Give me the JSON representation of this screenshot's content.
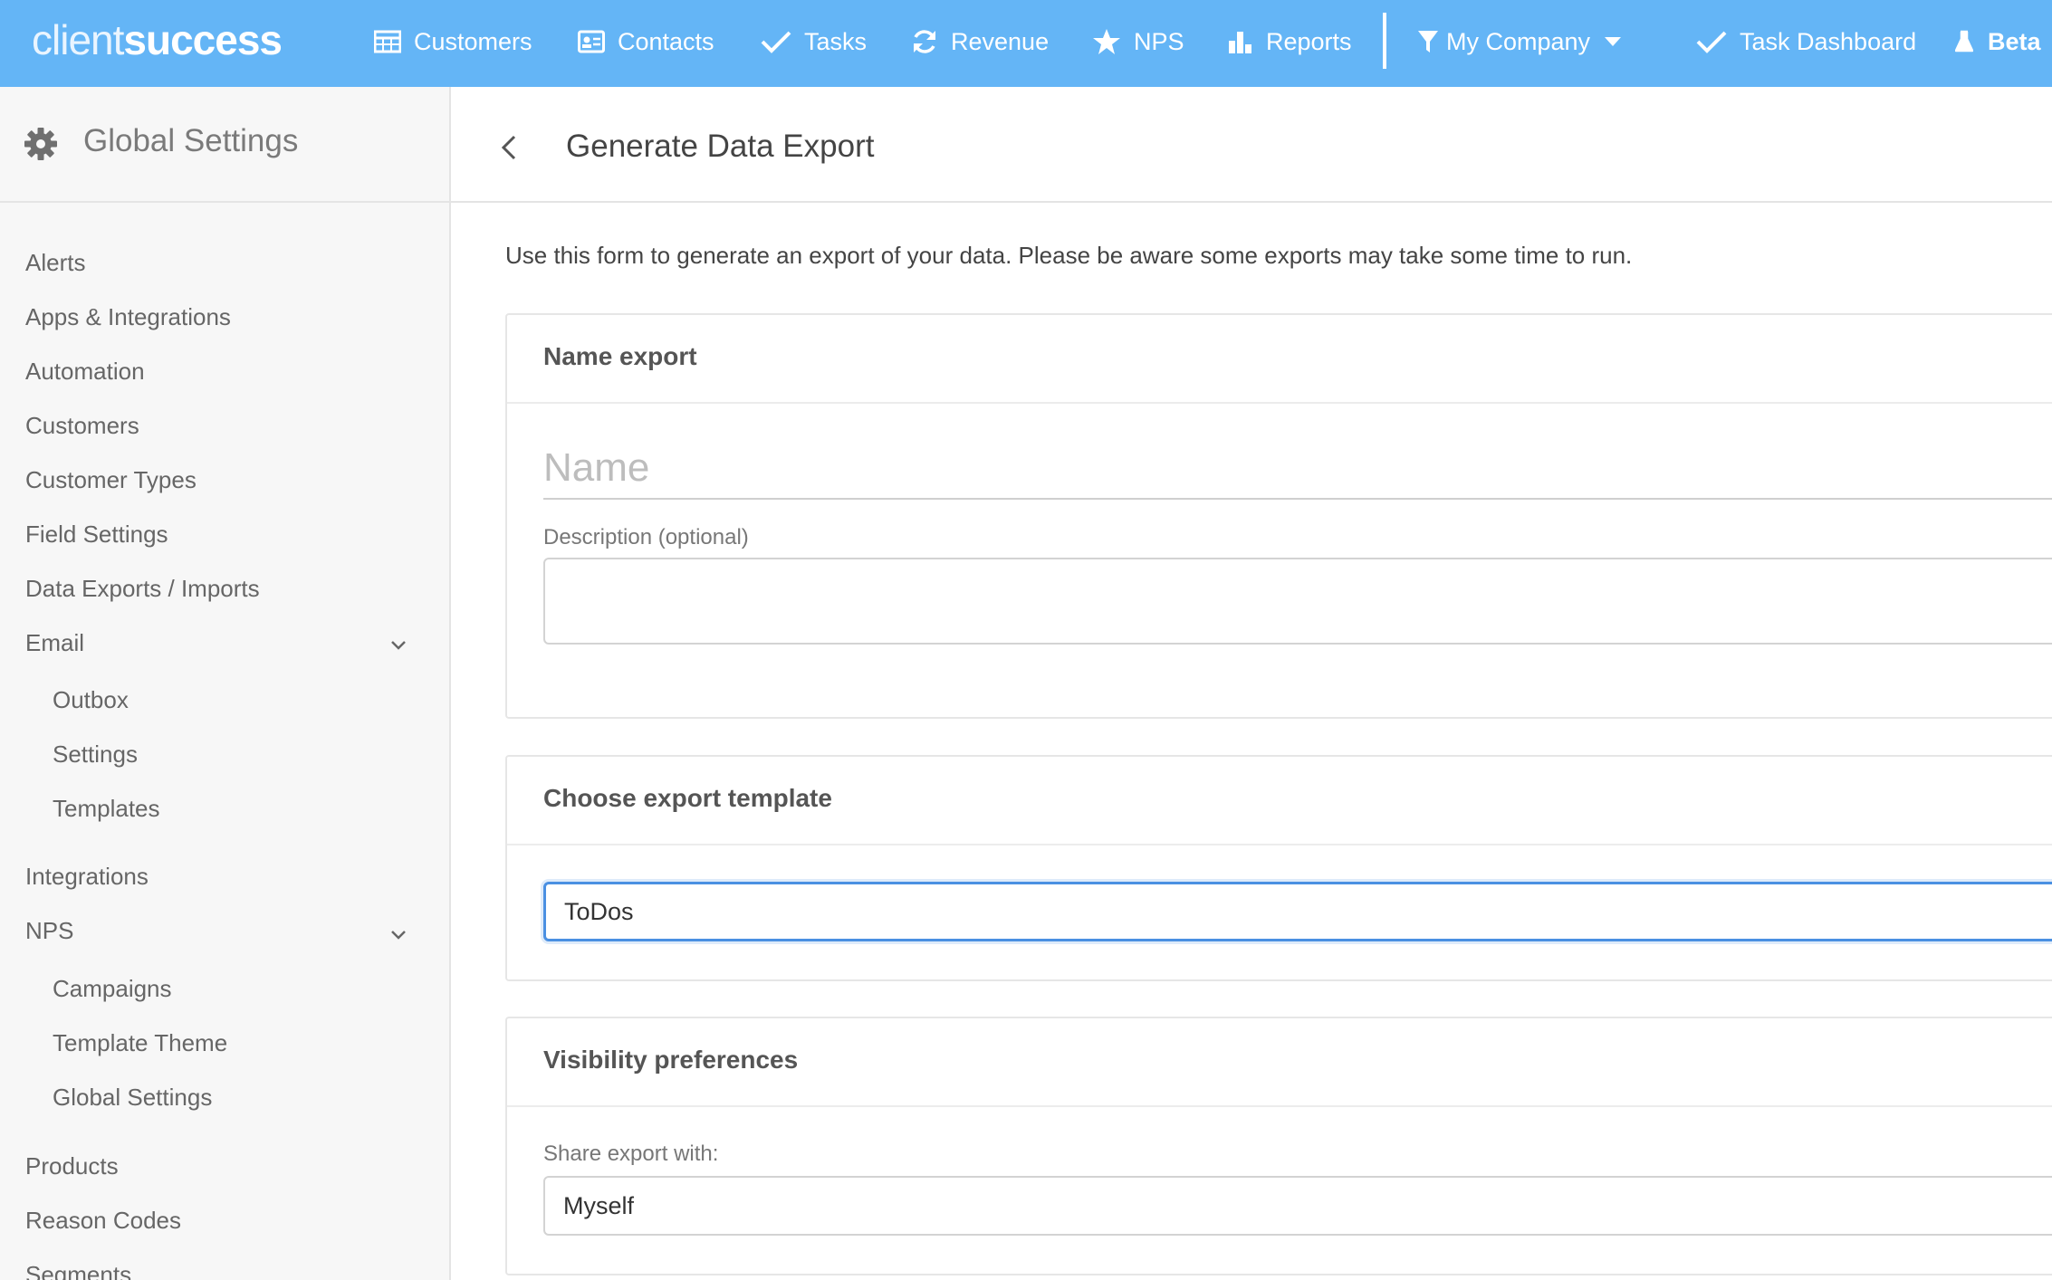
{
  "app": {
    "logo_light": "client",
    "logo_bold": "success"
  },
  "nav": {
    "items": [
      {
        "label": "Customers",
        "icon": "table-icon"
      },
      {
        "label": "Contacts",
        "icon": "contact-card-icon"
      },
      {
        "label": "Tasks",
        "icon": "checkmark-icon"
      },
      {
        "label": "Revenue",
        "icon": "refresh-icon"
      },
      {
        "label": "NPS",
        "icon": "star-icon"
      },
      {
        "label": "Reports",
        "icon": "bar-chart-icon"
      }
    ],
    "company_filter": "My Company",
    "task_dashboard": "Task Dashboard",
    "beta": "Beta"
  },
  "sidebar": {
    "title": "Global Settings",
    "items": [
      {
        "label": "Alerts"
      },
      {
        "label": "Apps & Integrations"
      },
      {
        "label": "Automation"
      },
      {
        "label": "Customers"
      },
      {
        "label": "Customer Types"
      },
      {
        "label": "Field Settings"
      },
      {
        "label": "Data Exports / Imports"
      },
      {
        "label": "Email",
        "expanded": true
      },
      {
        "label": "Outbox"
      },
      {
        "label": "Settings"
      },
      {
        "label": "Templates"
      },
      {
        "label": "Integrations"
      },
      {
        "label": "NPS",
        "expanded": true
      },
      {
        "label": "Campaigns"
      },
      {
        "label": "Template Theme"
      },
      {
        "label": "Global Settings"
      },
      {
        "label": "Products"
      },
      {
        "label": "Reason Codes"
      },
      {
        "label": "Segments"
      }
    ]
  },
  "main": {
    "title": "Generate Data Export",
    "intro": "Use this form to generate an export of your data. Please be aware some exports may take some time to run.",
    "name_section": {
      "heading": "Name export",
      "name_placeholder": "Name",
      "name_value": "",
      "description_label": "Description (optional)",
      "description_value": ""
    },
    "template_section": {
      "heading": "Choose export template",
      "selected": "ToDos"
    },
    "visibility_section": {
      "heading": "Visibility preferences",
      "share_label": "Share export with:",
      "selected": "Myself"
    }
  },
  "colors": {
    "topbar": "#64b5f6",
    "focus": "#4a90e2",
    "sidebar_bg": "#f7f7f7"
  }
}
